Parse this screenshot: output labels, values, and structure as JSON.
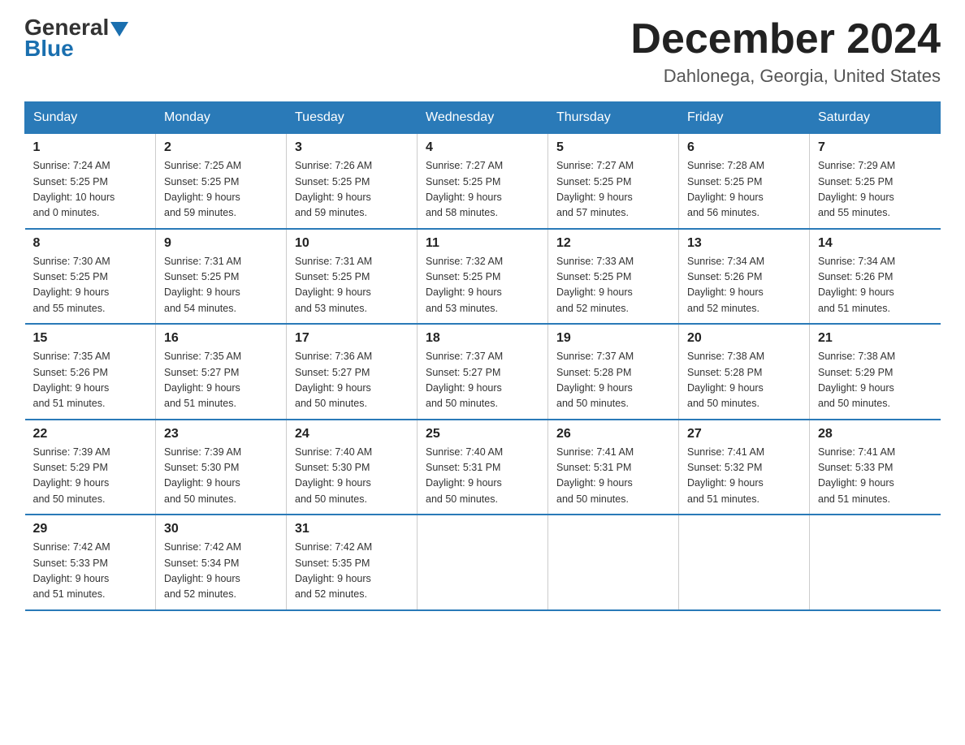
{
  "header": {
    "logo_general": "General",
    "logo_blue": "Blue",
    "month_title": "December 2024",
    "location": "Dahlonega, Georgia, United States"
  },
  "days_of_week": [
    "Sunday",
    "Monday",
    "Tuesday",
    "Wednesday",
    "Thursday",
    "Friday",
    "Saturday"
  ],
  "weeks": [
    [
      {
        "day": "1",
        "info": "Sunrise: 7:24 AM\nSunset: 5:25 PM\nDaylight: 10 hours\nand 0 minutes."
      },
      {
        "day": "2",
        "info": "Sunrise: 7:25 AM\nSunset: 5:25 PM\nDaylight: 9 hours\nand 59 minutes."
      },
      {
        "day": "3",
        "info": "Sunrise: 7:26 AM\nSunset: 5:25 PM\nDaylight: 9 hours\nand 59 minutes."
      },
      {
        "day": "4",
        "info": "Sunrise: 7:27 AM\nSunset: 5:25 PM\nDaylight: 9 hours\nand 58 minutes."
      },
      {
        "day": "5",
        "info": "Sunrise: 7:27 AM\nSunset: 5:25 PM\nDaylight: 9 hours\nand 57 minutes."
      },
      {
        "day": "6",
        "info": "Sunrise: 7:28 AM\nSunset: 5:25 PM\nDaylight: 9 hours\nand 56 minutes."
      },
      {
        "day": "7",
        "info": "Sunrise: 7:29 AM\nSunset: 5:25 PM\nDaylight: 9 hours\nand 55 minutes."
      }
    ],
    [
      {
        "day": "8",
        "info": "Sunrise: 7:30 AM\nSunset: 5:25 PM\nDaylight: 9 hours\nand 55 minutes."
      },
      {
        "day": "9",
        "info": "Sunrise: 7:31 AM\nSunset: 5:25 PM\nDaylight: 9 hours\nand 54 minutes."
      },
      {
        "day": "10",
        "info": "Sunrise: 7:31 AM\nSunset: 5:25 PM\nDaylight: 9 hours\nand 53 minutes."
      },
      {
        "day": "11",
        "info": "Sunrise: 7:32 AM\nSunset: 5:25 PM\nDaylight: 9 hours\nand 53 minutes."
      },
      {
        "day": "12",
        "info": "Sunrise: 7:33 AM\nSunset: 5:25 PM\nDaylight: 9 hours\nand 52 minutes."
      },
      {
        "day": "13",
        "info": "Sunrise: 7:34 AM\nSunset: 5:26 PM\nDaylight: 9 hours\nand 52 minutes."
      },
      {
        "day": "14",
        "info": "Sunrise: 7:34 AM\nSunset: 5:26 PM\nDaylight: 9 hours\nand 51 minutes."
      }
    ],
    [
      {
        "day": "15",
        "info": "Sunrise: 7:35 AM\nSunset: 5:26 PM\nDaylight: 9 hours\nand 51 minutes."
      },
      {
        "day": "16",
        "info": "Sunrise: 7:35 AM\nSunset: 5:27 PM\nDaylight: 9 hours\nand 51 minutes."
      },
      {
        "day": "17",
        "info": "Sunrise: 7:36 AM\nSunset: 5:27 PM\nDaylight: 9 hours\nand 50 minutes."
      },
      {
        "day": "18",
        "info": "Sunrise: 7:37 AM\nSunset: 5:27 PM\nDaylight: 9 hours\nand 50 minutes."
      },
      {
        "day": "19",
        "info": "Sunrise: 7:37 AM\nSunset: 5:28 PM\nDaylight: 9 hours\nand 50 minutes."
      },
      {
        "day": "20",
        "info": "Sunrise: 7:38 AM\nSunset: 5:28 PM\nDaylight: 9 hours\nand 50 minutes."
      },
      {
        "day": "21",
        "info": "Sunrise: 7:38 AM\nSunset: 5:29 PM\nDaylight: 9 hours\nand 50 minutes."
      }
    ],
    [
      {
        "day": "22",
        "info": "Sunrise: 7:39 AM\nSunset: 5:29 PM\nDaylight: 9 hours\nand 50 minutes."
      },
      {
        "day": "23",
        "info": "Sunrise: 7:39 AM\nSunset: 5:30 PM\nDaylight: 9 hours\nand 50 minutes."
      },
      {
        "day": "24",
        "info": "Sunrise: 7:40 AM\nSunset: 5:30 PM\nDaylight: 9 hours\nand 50 minutes."
      },
      {
        "day": "25",
        "info": "Sunrise: 7:40 AM\nSunset: 5:31 PM\nDaylight: 9 hours\nand 50 minutes."
      },
      {
        "day": "26",
        "info": "Sunrise: 7:41 AM\nSunset: 5:31 PM\nDaylight: 9 hours\nand 50 minutes."
      },
      {
        "day": "27",
        "info": "Sunrise: 7:41 AM\nSunset: 5:32 PM\nDaylight: 9 hours\nand 51 minutes."
      },
      {
        "day": "28",
        "info": "Sunrise: 7:41 AM\nSunset: 5:33 PM\nDaylight: 9 hours\nand 51 minutes."
      }
    ],
    [
      {
        "day": "29",
        "info": "Sunrise: 7:42 AM\nSunset: 5:33 PM\nDaylight: 9 hours\nand 51 minutes."
      },
      {
        "day": "30",
        "info": "Sunrise: 7:42 AM\nSunset: 5:34 PM\nDaylight: 9 hours\nand 52 minutes."
      },
      {
        "day": "31",
        "info": "Sunrise: 7:42 AM\nSunset: 5:35 PM\nDaylight: 9 hours\nand 52 minutes."
      },
      {
        "day": "",
        "info": ""
      },
      {
        "day": "",
        "info": ""
      },
      {
        "day": "",
        "info": ""
      },
      {
        "day": "",
        "info": ""
      }
    ]
  ]
}
